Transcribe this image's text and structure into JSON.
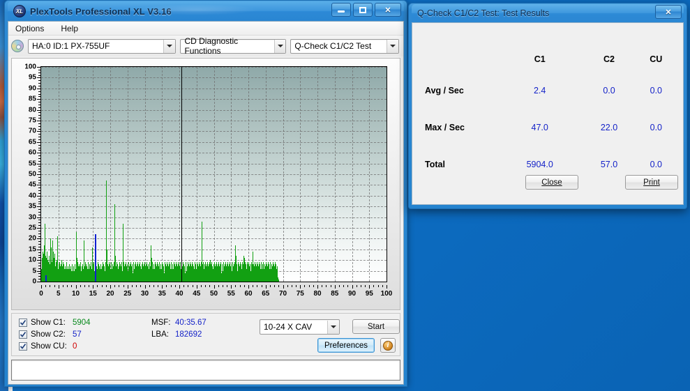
{
  "app": {
    "title": "PlexTools Professional XL V3.16",
    "logo_text": "XL",
    "window_buttons": {
      "minimize": "minimize-button",
      "maximize": "maximize-button",
      "close": "✕"
    },
    "menu": [
      "Options",
      "Help"
    ],
    "toolbar": {
      "drive": "HA:0 ID:1  PX-755UF",
      "function": "CD Diagnostic Functions",
      "test": "Q-Check C1/C2 Test"
    }
  },
  "controls": {
    "show_c1_label": "Show C1:",
    "show_c2_label": "Show C2:",
    "show_cu_label": "Show CU:",
    "c1_value": "5904",
    "c2_value": "57",
    "cu_value": "0",
    "msf_label": "MSF:",
    "msf_value": "40:35.67",
    "lba_label": "LBA:",
    "lba_value": "182692",
    "speed": "10-24 X CAV",
    "start_label": "Start",
    "preferences_label": "Preferences",
    "info_label": "i",
    "status_text": ""
  },
  "dialog": {
    "title": "Q-Check C1/C2 Test: Test Results",
    "close_glyph": "✕",
    "columns": [
      "C1",
      "C2",
      "CU"
    ],
    "rows": [
      {
        "label": "Avg / Sec",
        "values": [
          "2.4",
          "0.0",
          "0.0"
        ]
      },
      {
        "label": "Max / Sec",
        "values": [
          "47.0",
          "22.0",
          "0.0"
        ]
      },
      {
        "label": "Total",
        "values": [
          "5904.0",
          "57.0",
          "0.0"
        ]
      }
    ],
    "close_button": "Close",
    "print_button": "Print"
  },
  "chart_data": {
    "type": "bar",
    "title": "",
    "xlabel": "",
    "ylabel": "",
    "xlim": [
      0,
      100
    ],
    "ylim": [
      0,
      100
    ],
    "xticks": [
      0,
      5,
      10,
      15,
      20,
      25,
      30,
      35,
      40,
      45,
      50,
      55,
      60,
      65,
      70,
      75,
      80,
      85,
      90,
      95,
      100
    ],
    "yticks": [
      0,
      5,
      10,
      15,
      20,
      25,
      30,
      35,
      40,
      45,
      50,
      55,
      60,
      65,
      70,
      75,
      80,
      85,
      90,
      95,
      100
    ],
    "grid": true,
    "legend": [
      "C1",
      "C2",
      "CU"
    ],
    "colors": {
      "c1": "#12A012",
      "c2": "#1020D0",
      "cu": "#d00000",
      "endline": "#000000"
    },
    "data_end_x": 40.7,
    "series": [
      {
        "name": "C1",
        "color": "#12A012",
        "x_step": 0.0815,
        "values": [
          2,
          6,
          11,
          9,
          14,
          12,
          10,
          8,
          13,
          17,
          9,
          7,
          12,
          27,
          12,
          9,
          7,
          11,
          8,
          14,
          7,
          6,
          10,
          8,
          5,
          9,
          7,
          12,
          6,
          8,
          4,
          7,
          20,
          13,
          10,
          16,
          6,
          9,
          7,
          11,
          19,
          14,
          8,
          6,
          9,
          11,
          6,
          8,
          13,
          7,
          5,
          9,
          6,
          8,
          10,
          5,
          7,
          21,
          9,
          6,
          5,
          8,
          4,
          6,
          9,
          5,
          7,
          4,
          6,
          8,
          5,
          10,
          6,
          4,
          7,
          5,
          9,
          6,
          4,
          8,
          5,
          3,
          6,
          4,
          5,
          7,
          4,
          6,
          9,
          5,
          4,
          6,
          3,
          5,
          7,
          4,
          6,
          5,
          8,
          4,
          3,
          6,
          5,
          7,
          4,
          6,
          3,
          5,
          8,
          4,
          6,
          5,
          3,
          7,
          4,
          6,
          5,
          4,
          8,
          5,
          3,
          6,
          4,
          5,
          7,
          23,
          11,
          8,
          6,
          9,
          5,
          7,
          4,
          6,
          8,
          5,
          3,
          7,
          4,
          6,
          9,
          5,
          4,
          7,
          6,
          3,
          5,
          8,
          4,
          6,
          19,
          12,
          8,
          5,
          7,
          4,
          9,
          6,
          5,
          8,
          4,
          7,
          3,
          6,
          5,
          9,
          4,
          7,
          6,
          3,
          5,
          8,
          4,
          6,
          7,
          5,
          3,
          9,
          4,
          6,
          16,
          10,
          7,
          5,
          8,
          4,
          6,
          9,
          5,
          3,
          7,
          4,
          6,
          8,
          5,
          4,
          7,
          3,
          6,
          5,
          9,
          4,
          6,
          8,
          5,
          3,
          7,
          4,
          6,
          5,
          4,
          8,
          6,
          3,
          5,
          7,
          4,
          9,
          6,
          5,
          3,
          8,
          4,
          6,
          7,
          5,
          4,
          9,
          3,
          6,
          47,
          22,
          15,
          9,
          6,
          4,
          8,
          5,
          7,
          3,
          6,
          9,
          4,
          5,
          8,
          6,
          3,
          7,
          4,
          9,
          5,
          6,
          3,
          8,
          4,
          7,
          5,
          6,
          9,
          3,
          36,
          18,
          12,
          8,
          5,
          7,
          4,
          6,
          9,
          5,
          3,
          8,
          4,
          6,
          7,
          5,
          4,
          9,
          3,
          6,
          8,
          5,
          4,
          7,
          3,
          6,
          9,
          5,
          4,
          8,
          27,
          14,
          9,
          6,
          4,
          7,
          5,
          3,
          8,
          6,
          4,
          9,
          5,
          7,
          3,
          6,
          8,
          4,
          5,
          9,
          6,
          3,
          7,
          4,
          8,
          5,
          6,
          3,
          9,
          4,
          7,
          5,
          6,
          8,
          3,
          4,
          9,
          5,
          7,
          6,
          3,
          8,
          4,
          5,
          9,
          6,
          7,
          3,
          4,
          8,
          5,
          6,
          9,
          4,
          3,
          7,
          5,
          8,
          6,
          4,
          9,
          3,
          5,
          7,
          6,
          4,
          8,
          5,
          3,
          9,
          4,
          6,
          7,
          5,
          3,
          8,
          9,
          4,
          6,
          5,
          7,
          3,
          8,
          4,
          6,
          9,
          5,
          3,
          7,
          4,
          8,
          6,
          5,
          9,
          3,
          4,
          7,
          5,
          6,
          8,
          17,
          11,
          7,
          5,
          9,
          4,
          6,
          3,
          8,
          5,
          7,
          4,
          6,
          9,
          3,
          5,
          8,
          4,
          7,
          6,
          5,
          3,
          9,
          4,
          6,
          8,
          5,
          7,
          3,
          4,
          9,
          6,
          5,
          8,
          3,
          7,
          4,
          6,
          5,
          9,
          3,
          8,
          4,
          7,
          6,
          5,
          4,
          3,
          9,
          6,
          5,
          8,
          4,
          7,
          3,
          6,
          9,
          5,
          4,
          8,
          3,
          7,
          6,
          5,
          9,
          4,
          8,
          3,
          6,
          5,
          7,
          4,
          9,
          6,
          3,
          8,
          5,
          7,
          4,
          6,
          3,
          9,
          5,
          8,
          4,
          7,
          6,
          3,
          5,
          9,
          4,
          8,
          6,
          3,
          7,
          5,
          9,
          4,
          6,
          8,
          3,
          5,
          7,
          4,
          9,
          6,
          5,
          3,
          8,
          4,
          7,
          6,
          5,
          9,
          3,
          4,
          8,
          6,
          5,
          7,
          4,
          3,
          9,
          6,
          8,
          5,
          4,
          7,
          3,
          6,
          9,
          5,
          8,
          4,
          3,
          7,
          6,
          5,
          9,
          4,
          8,
          3,
          6,
          5,
          7,
          4,
          9,
          6,
          3,
          8,
          5,
          7,
          4,
          6,
          3,
          9,
          5,
          8,
          4,
          7,
          6,
          3,
          5,
          9,
          4,
          8,
          6,
          3,
          7,
          5,
          9,
          4,
          6,
          8,
          3,
          5,
          7,
          4,
          9,
          6,
          28,
          13,
          8,
          5,
          9,
          4,
          7,
          3,
          6,
          8,
          5,
          4,
          9,
          3,
          7,
          6,
          5,
          8,
          4,
          3,
          9,
          6,
          7,
          5,
          4,
          8,
          3,
          6,
          9,
          5,
          10,
          7,
          4,
          8,
          3,
          6,
          9,
          5,
          7,
          4,
          6,
          3,
          8,
          5,
          9,
          4,
          7,
          6,
          3,
          5,
          8,
          4,
          9,
          6,
          7,
          3,
          5,
          8,
          4,
          6,
          9,
          5,
          3,
          7,
          4,
          8,
          6,
          5,
          9,
          3,
          4,
          7,
          6,
          8,
          5,
          3,
          9,
          4,
          6,
          7,
          5,
          8,
          3,
          4,
          9,
          6,
          5,
          7,
          4,
          8,
          3,
          6,
          9,
          5,
          4,
          7,
          8,
          3,
          6,
          5,
          9,
          4,
          7,
          3,
          6,
          8,
          5,
          4,
          9,
          6,
          3,
          7,
          5,
          8,
          4,
          6,
          9,
          3,
          5,
          7,
          17,
          12,
          9,
          6,
          4,
          8,
          5,
          3,
          7,
          9,
          6,
          4,
          8,
          5,
          3,
          7,
          6,
          9,
          4,
          5,
          8,
          3,
          6,
          7,
          4,
          9,
          5,
          8,
          3,
          6,
          12,
          11,
          10,
          9,
          7,
          5,
          8,
          4,
          6,
          3,
          9,
          7,
          5,
          8,
          4,
          6,
          3,
          9,
          5,
          7,
          4,
          8,
          6,
          3,
          5,
          9,
          4,
          7,
          6,
          8,
          14,
          9,
          6,
          4,
          8,
          5,
          7,
          3,
          9,
          6,
          4,
          8,
          5,
          3,
          7,
          6,
          4,
          9,
          5,
          8,
          3,
          6,
          7,
          4,
          9,
          5,
          3,
          8,
          6,
          4,
          7,
          5,
          9,
          3,
          6,
          8,
          4,
          5,
          7,
          9,
          3,
          6,
          4,
          8,
          5,
          7,
          3,
          9,
          6,
          4,
          5,
          8,
          3,
          7,
          6,
          9,
          4,
          5,
          3,
          8,
          6,
          4,
          7,
          5,
          9,
          3,
          6,
          8,
          4,
          5,
          7,
          3,
          9,
          6,
          4,
          8,
          5,
          3,
          7,
          6,
          4,
          9,
          5,
          3,
          8,
          6,
          4,
          7,
          5,
          3,
          2,
          1,
          1,
          0,
          0,
          0,
          0,
          0,
          0,
          0,
          0,
          0,
          0,
          0,
          0,
          0,
          0,
          0,
          0,
          0
        ]
      },
      {
        "name": "C2",
        "color": "#1020D0",
        "spikes": [
          {
            "x": 1.3,
            "value": 3
          },
          {
            "x": 15.5,
            "value": 22
          },
          {
            "x": 15.6,
            "value": 5
          }
        ]
      }
    ]
  }
}
